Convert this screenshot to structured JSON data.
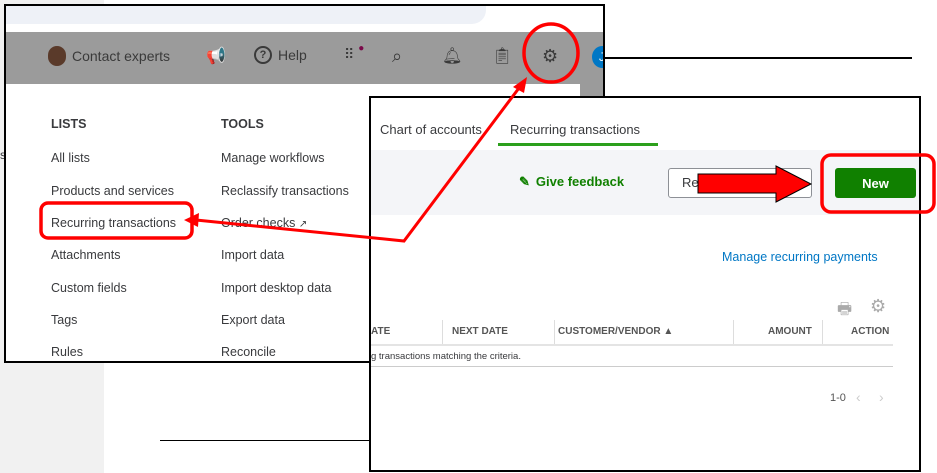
{
  "header": {
    "contact_experts": "Contact experts",
    "help": "Help",
    "avatar_initial": "J"
  },
  "left_edge_text": "s",
  "menu": {
    "lists": {
      "heading": "LISTS",
      "items": [
        "All lists",
        "Products and services",
        "Recurring transactions",
        "Attachments",
        "Custom fields",
        "Tags",
        "Rules"
      ]
    },
    "tools": {
      "heading": "TOOLS",
      "items": [
        "Manage workflows",
        "Reclassify transactions",
        "Order checks",
        "Import data",
        "Import desktop data",
        "Export data",
        "Reconcile"
      ]
    }
  },
  "page": {
    "tabs": [
      "Chart of accounts",
      "Recurring transactions"
    ],
    "active_tab": "Recurring transactions",
    "give_feedback": "Give feedback",
    "reports_button_partial": "Re",
    "new_button": "New",
    "manage_link": "Manage recurring payments",
    "table": {
      "headers": [
        "ATE",
        "NEXT DATE",
        "CUSTOMER/VENDOR ▲",
        "AMOUNT",
        "ACTION"
      ],
      "empty_message": "g transactions matching the criteria."
    },
    "pagination": "1-0"
  },
  "colors": {
    "accent_green": "#108000",
    "link_blue": "#0077c5",
    "annotation_red": "#ff0000",
    "header_gray": "#9b9b9b"
  }
}
